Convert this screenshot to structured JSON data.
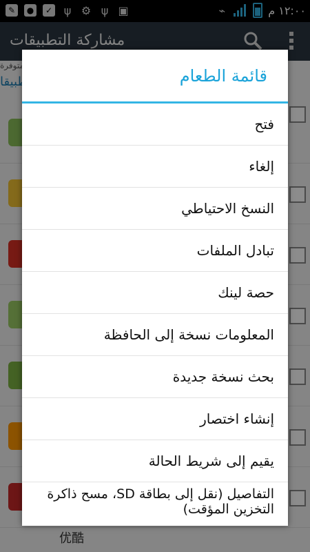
{
  "status_bar": {
    "left_icons": [
      "edit-icon",
      "notification-icon",
      "check-icon",
      "usb-icon",
      "android-icon",
      "usb-icon",
      "image-icon"
    ],
    "time": "١٢:٠٠ م"
  },
  "action_bar": {
    "title": "مشاركة التطبيقات"
  },
  "background": {
    "subtitle_fragment": "متوفرة",
    "tab_fragment": "تطبيقا",
    "bottom_text": "优酷"
  },
  "dialog": {
    "title": "قائمة الطعام",
    "items": [
      {
        "label": "فتح"
      },
      {
        "label": "إلغاء"
      },
      {
        "label": "النسخ الاحتياطي"
      },
      {
        "label": "تبادل الملفات"
      },
      {
        "label": "حصة لينك"
      },
      {
        "label": "المعلومات نسخة إلى الحافظة"
      },
      {
        "label": "بحث نسخة جديدة"
      },
      {
        "label": "إنشاء اختصار"
      },
      {
        "label": "يقيم إلى شريط الحالة"
      },
      {
        "label": "التفاصيل (نقل إلى بطاقة SD، مسح ذاكرة التخزين المؤقت)"
      }
    ]
  },
  "colors": {
    "accent": "#33b5e5",
    "title_blue": "#1aa3d9",
    "actionbar_bg": "#2a3640"
  }
}
